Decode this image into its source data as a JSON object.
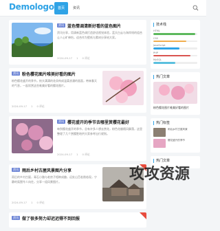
{
  "header": {
    "logo": "Demologo",
    "nav": [
      "首页",
      "资讯"
    ],
    "search_icon": "search-icon"
  },
  "posts": [
    {
      "category": "资讯",
      "title": "蓝色情调清新好看的蓝色图片",
      "excerpt": "资讯分享，用清新蓝色调打造舒适视觉体验，蓝天白云与海岸线的组合让人心旷神怡，适合作为壁纸与素材分享给大家。",
      "date": "2024-09-17",
      "views": "1",
      "comments": "0 评论"
    },
    {
      "category": "资讯",
      "title": "粉色樱花图片唯美好看的图片",
      "excerpt": "粉色樱花盛开的季节，枝头满满的花朵构成温柔浪漫的画面，带来春天的气息，一起欣赏这些唯美好看的樱花图片。",
      "date": "2024-09-17",
      "views": "1",
      "comments": "0 评论"
    },
    {
      "category": "资讯",
      "title": "樱花盛开的季节去哪里赏樱花最好",
      "excerpt": "每到樱花盛开的季节，总有许多人想去赏花，粉色花瓣随风飘落，这里整理了几个赏樱胜地供大家参考出行规划。",
      "date": "2024-09-17",
      "views": "1",
      "comments": "0 评论"
    },
    {
      "category": "资讯",
      "title": "雨后乡村古屋风景图片分享",
      "excerpt": "雨后的乡村古屋，青石小路与老房子相映成趣，远处山峦若隐若现，宁静的氛围令人向往，分享一组风景图片。",
      "date": "2024-09-17",
      "views": "1",
      "comments": "0 评论"
    },
    {
      "category": "资讯",
      "title": "做了很多努力却迟迟得不到回报"
    }
  ],
  "sidebar": {
    "widget1_title": "技术栈",
    "bars": [
      {
        "label": "HTML",
        "value": 0.95,
        "color": "#5cb85c"
      },
      {
        "label": "CSS",
        "value": 0.75,
        "color": "#f0ad4e"
      },
      {
        "label": "JavaScript",
        "value": 0.6,
        "color": "#2fa3e6"
      },
      {
        "label": "PHP",
        "value": 0.85,
        "color": "#d9534f"
      },
      {
        "label": "MySQL",
        "value": 0.5,
        "color": "#5bc0de"
      }
    ],
    "widget2_title": "热门文章",
    "hot_text": "粉色樱花图片唯美好看的图片",
    "widget3_title": "热门标签",
    "list": [
      "雨后乡村古屋风景",
      "樱花盛开的季节"
    ],
    "widget4_title": "热门文章"
  },
  "watermark": "攻攻资源"
}
